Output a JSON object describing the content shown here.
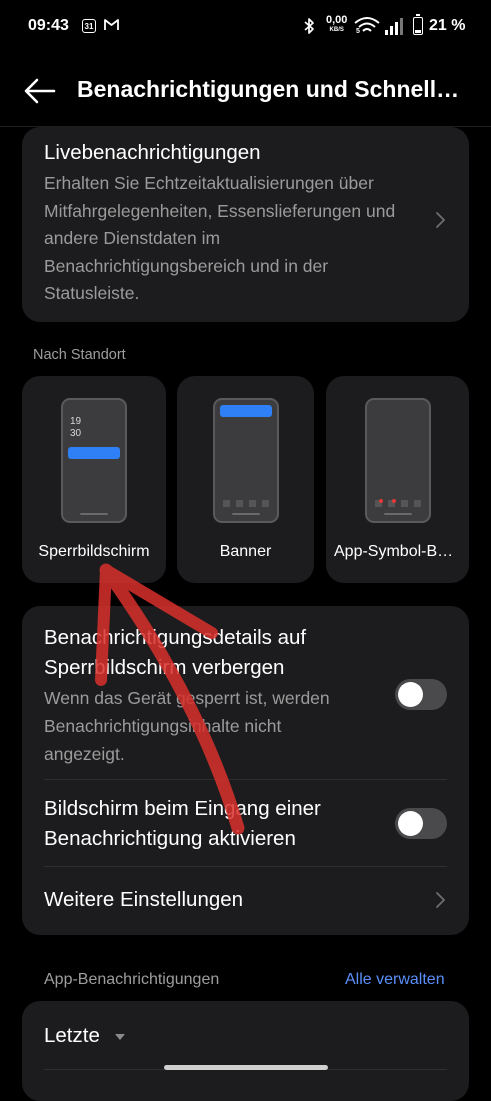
{
  "status_bar": {
    "time": "09:43",
    "calendar_day": "31",
    "speed_value": "0,00",
    "speed_unit": "KB/S",
    "wifi_label": "5",
    "battery_percent": "21 %"
  },
  "header": {
    "title": "Benachrichtigungen und Schnelleinstellungen"
  },
  "live_notifications": {
    "title": "Livebenachrichtigungen",
    "description": "Erhalten Sie Echtzeitaktualisierungen über Mitfahrgelegenheiten, Essenslieferungen und andere Dienstdaten im Benachrichtigungsbereich und in der Statusleiste."
  },
  "by_location": {
    "section_label": "Nach Standort",
    "options": [
      {
        "label": "Sperrbildschirm",
        "preview_time_hour": "19",
        "preview_time_min": "30"
      },
      {
        "label": "Banner"
      },
      {
        "label": "App-Symbol-Badges"
      }
    ]
  },
  "settings": {
    "hide_details_title": "Benachrichtigungsdetails auf Sperrbildschirm verbergen",
    "hide_details_desc": "Wenn das Gerät gesperrt ist, werden Benachrichtigungsinhalte nicht angezeigt.",
    "hide_details_on": false,
    "wake_screen_title": "Bildschirm beim Eingang einer Benachrichtigung aktivieren",
    "wake_screen_on": false,
    "more_settings": "Weitere Einstellungen"
  },
  "app_notifications": {
    "section_label": "App-Benachrichtigungen",
    "manage_all": "Alle verwalten",
    "filter_label": "Letzte"
  },
  "colors": {
    "accent_blue": "#2f80f6",
    "badge_red": "#e53935",
    "annotation_red": "#d9302c",
    "card_bg": "#1c1c1e"
  }
}
